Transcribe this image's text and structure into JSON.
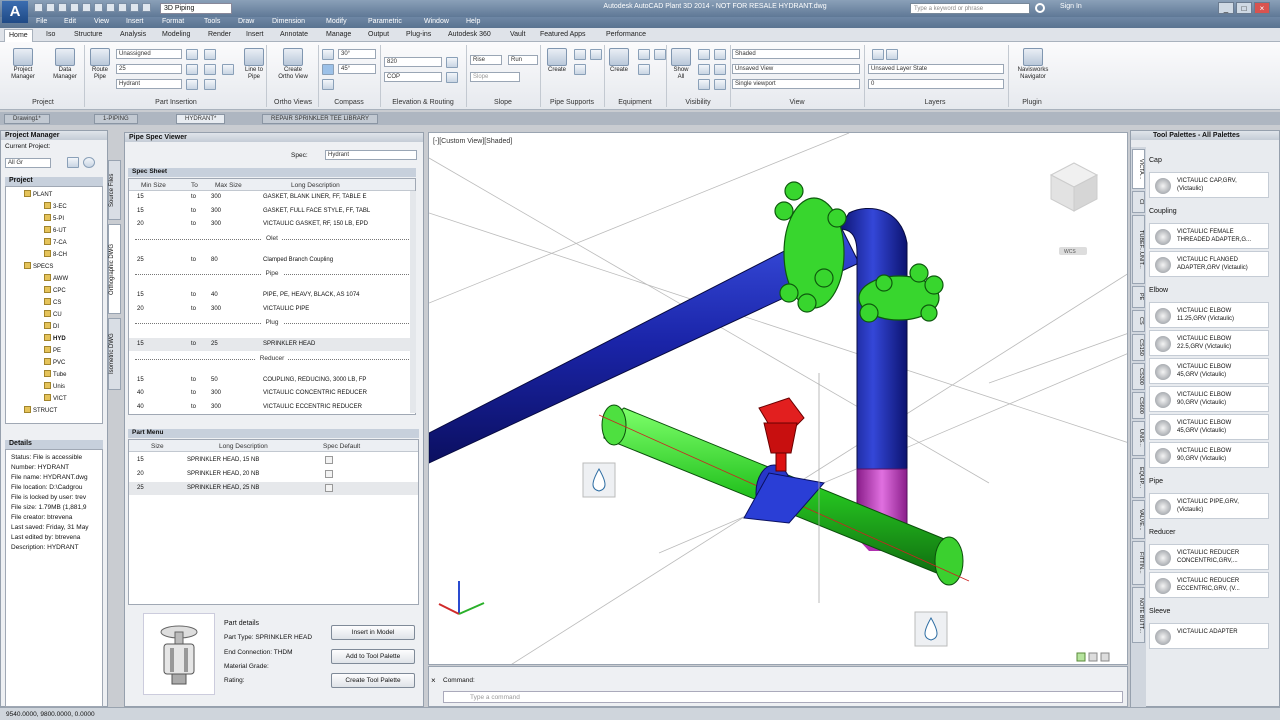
{
  "titlebar": {
    "workspace": "3D Piping",
    "app_title": "Autodesk AutoCAD Plant 3D 2014 - NOT FOR RESALE   HYDRANT.dwg",
    "search_placeholder": "Type a keyword or phrase",
    "sign_in": "Sign In"
  },
  "menubar": [
    "File",
    "Edit",
    "View",
    "Insert",
    "Format",
    "Tools",
    "Draw",
    "Dimension",
    "Modify",
    "Parametric",
    "Window",
    "Help"
  ],
  "ribbon_tabs": [
    "Home",
    "Iso",
    "Structure",
    "Analysis",
    "Modeling",
    "Render",
    "Insert",
    "Annotate",
    "Manage",
    "Output",
    "Plug-ins",
    "Autodesk 360",
    "Vault",
    "Featured Apps",
    "Performance"
  ],
  "ribbon": {
    "project_manager": "Project\nManager",
    "data_manager": "Data\nManager",
    "route_pipe": "Route\nPipe",
    "spec_unassigned": "Unassigned",
    "size_value": "25",
    "spec_value": "Hydrant",
    "line_to_pipe": "Line to\nPipe",
    "create_ortho": "Create\nOrtho View",
    "angle1": "30°",
    "angle2": "45°",
    "elev": "820",
    "cop": "COP",
    "rise": "Rise",
    "run": "Run",
    "slope": "Slope",
    "create_support": "Create",
    "create_equip": "Create",
    "show_all": "Show\nAll",
    "visual_style": "Shaded",
    "view_name": "Unsaved View",
    "viewport": "Single viewport",
    "layer_state": "Unsaved Layer State",
    "layer_num": "0",
    "navisworks": "Navisworks\nNavigator",
    "panels": [
      "Project",
      "Part Insertion",
      "Ortho Views",
      "Compass",
      "Elevation & Routing",
      "Slope",
      "Pipe Supports",
      "Equipment",
      "Visibility",
      "View",
      "Layers",
      "Plugin"
    ]
  },
  "doc_tabs": [
    "Drawing1*",
    "1-PIPING",
    "HYDRANT*",
    "REPAIR SPRINKLER TEE LIBRARY"
  ],
  "project_manager": {
    "title": "Project Manager",
    "current_project": "Current Project:",
    "project_drop": "All Gr",
    "project_head": "Project",
    "tree": [
      {
        "label": "PLANT",
        "indent": 28,
        "exp": "-"
      },
      {
        "label": "3-EC",
        "indent": 48
      },
      {
        "label": "5-PI",
        "indent": 48
      },
      {
        "label": "6-UT",
        "indent": 48
      },
      {
        "label": "7-CA",
        "indent": 48
      },
      {
        "label": "8-CH",
        "indent": 48
      },
      {
        "label": "SPECS",
        "indent": 28,
        "exp": "-"
      },
      {
        "label": "AWW",
        "indent": 48
      },
      {
        "label": "CPC",
        "indent": 48
      },
      {
        "label": "CS",
        "indent": 48
      },
      {
        "label": "CU",
        "indent": 48
      },
      {
        "label": "DI",
        "indent": 48
      },
      {
        "label": "HYD",
        "indent": 48,
        "bold": true
      },
      {
        "label": "PE",
        "indent": 48
      },
      {
        "label": "PVC",
        "indent": 48
      },
      {
        "label": "Tube",
        "indent": 48
      },
      {
        "label": "Unis",
        "indent": 48
      },
      {
        "label": "VICT",
        "indent": 48
      },
      {
        "label": "STRUCT",
        "indent": 28,
        "exp": "+"
      }
    ],
    "details_head": "Details",
    "details": [
      "Status: File is accessible",
      "Number: HYDRANT",
      "File name: HYDRANT.dwg",
      "File location: D:\\Cadgrou",
      "File is locked by user: trev",
      "File size: 1.79MB (1,881,9",
      "File creator: btrevena",
      "Last saved: Friday, 31 May",
      "Last edited by: btrevena",
      "Description: HYDRANT"
    ]
  },
  "side_tabs": [
    "Source Files",
    "Orthographic DWG",
    "Isometric DWG"
  ],
  "psv": {
    "title": "Pipe Spec Viewer",
    "spec_label": "Spec:",
    "spec_value": "Hydrant",
    "spec_sheet": "Spec Sheet",
    "cols": [
      "Min Size",
      "To",
      "Max Size",
      "Long Description"
    ],
    "rows": [
      {
        "t": "row",
        "min": "15",
        "to": "to",
        "max": "300",
        "desc": "GASKET, BLANK LINER, FF, TABLE E"
      },
      {
        "t": "row",
        "min": "15",
        "to": "to",
        "max": "300",
        "desc": "GASKET, FULL FACE STYLE, FF, TABL"
      },
      {
        "t": "row",
        "min": "20",
        "to": "to",
        "max": "300",
        "desc": "VICTAULIC GASKET, RF, 150 LB, EPD"
      },
      {
        "t": "grp",
        "label": "Olet"
      },
      {
        "t": "row",
        "min": "25",
        "to": "to",
        "max": "80",
        "desc": "Clamped Branch Coupling"
      },
      {
        "t": "grp",
        "label": "Pipe"
      },
      {
        "t": "row",
        "min": "15",
        "to": "to",
        "max": "40",
        "desc": "PIPE, PE, HEAVY, BLACK, AS 1074"
      },
      {
        "t": "row",
        "min": "20",
        "to": "to",
        "max": "300",
        "desc": "VICTAULIC PIPE"
      },
      {
        "t": "grp",
        "label": "Plug"
      },
      {
        "t": "row",
        "min": "15",
        "to": "to",
        "max": "25",
        "desc": "SPRINKLER HEAD",
        "sel": true
      },
      {
        "t": "grp",
        "label": "Reducer"
      },
      {
        "t": "row",
        "min": "15",
        "to": "to",
        "max": "50",
        "desc": "COUPLING, REDUCING, 3000 LB, FP"
      },
      {
        "t": "row",
        "min": "40",
        "to": "to",
        "max": "300",
        "desc": "VICTAULIC CONCENTRIC REDUCER"
      },
      {
        "t": "row",
        "min": "40",
        "to": "to",
        "max": "300",
        "desc": "VICTAULIC ECCENTRIC REDUCER"
      }
    ],
    "part_menu": "Part Menu",
    "part_cols": [
      "Size",
      "Long Description",
      "Spec Default"
    ],
    "parts": [
      {
        "size": "15",
        "desc": "SPRINKLER HEAD, 15 NB"
      },
      {
        "size": "20",
        "desc": "SPRINKLER HEAD, 20 NB"
      },
      {
        "size": "25",
        "desc": "SPRINKLER HEAD, 25 NB",
        "sel": true
      }
    ],
    "part_details_title": "Part details",
    "part_type": "Part Type: SPRINKLER HEAD",
    "end_conn": "End Connection: THDM",
    "material": "Material Grade:",
    "rating": "Rating:",
    "btn_insert": "Insert in Model",
    "btn_add_tp": "Add to Tool Palette",
    "btn_create_tp": "Create Tool Palette"
  },
  "viewport": {
    "label": "[-][Custom View][Shaded]",
    "viewcube_face": "WCS"
  },
  "command": {
    "label": "Command:",
    "placeholder": "Type a command"
  },
  "status": {
    "coords": "9540.0000, 9800.0000, 0.0000"
  },
  "tool_palettes": {
    "title": "Tool Palettes - All Palettes",
    "tabs": [
      "VICTA...",
      "CI",
      "TUBEF...UNIT...",
      "PE",
      "CS",
      "CS150",
      "CS300",
      "CS600",
      "UNIS...",
      "EQUIP...",
      "VALVE...",
      "FITTIN...",
      "NOTE BUTT..."
    ],
    "sections": [
      {
        "name": "Cap",
        "items": [
          "VICTAULIC CAP,GRV,\n(Victaulic)"
        ]
      },
      {
        "name": "Coupling",
        "items": [
          "VICTAULIC FEMALE\nTHREADED ADAPTER,G...",
          "VICTAULIC FLANGED\nADAPTER,GRV (Victaulic)"
        ]
      },
      {
        "name": "Elbow",
        "items": [
          "VICTAULIC ELBOW\n11.25,GRV (Victaulic)",
          "VICTAULIC ELBOW\n22.5,GRV (Victaulic)",
          "VICTAULIC ELBOW\n45,GRV (Victaulic)",
          "VICTAULIC ELBOW\n90,GRV (Victaulic)",
          "VICTAULIC ELBOW\n45,GRV (Victaulic)",
          "VICTAULIC ELBOW\n90,GRV (Victaulic)"
        ]
      },
      {
        "name": "Pipe",
        "items": [
          "VICTAULIC PIPE,GRV,\n(Victaulic)"
        ]
      },
      {
        "name": "Reducer",
        "items": [
          "VICTAULIC REDUCER\nCONCENTRIC,GRV,...",
          "VICTAULIC REDUCER\nECCENTRIC,GRV, (V..."
        ]
      },
      {
        "name": "Sleeve",
        "items": [
          "VICTAULIC ADAPTER"
        ]
      }
    ]
  }
}
